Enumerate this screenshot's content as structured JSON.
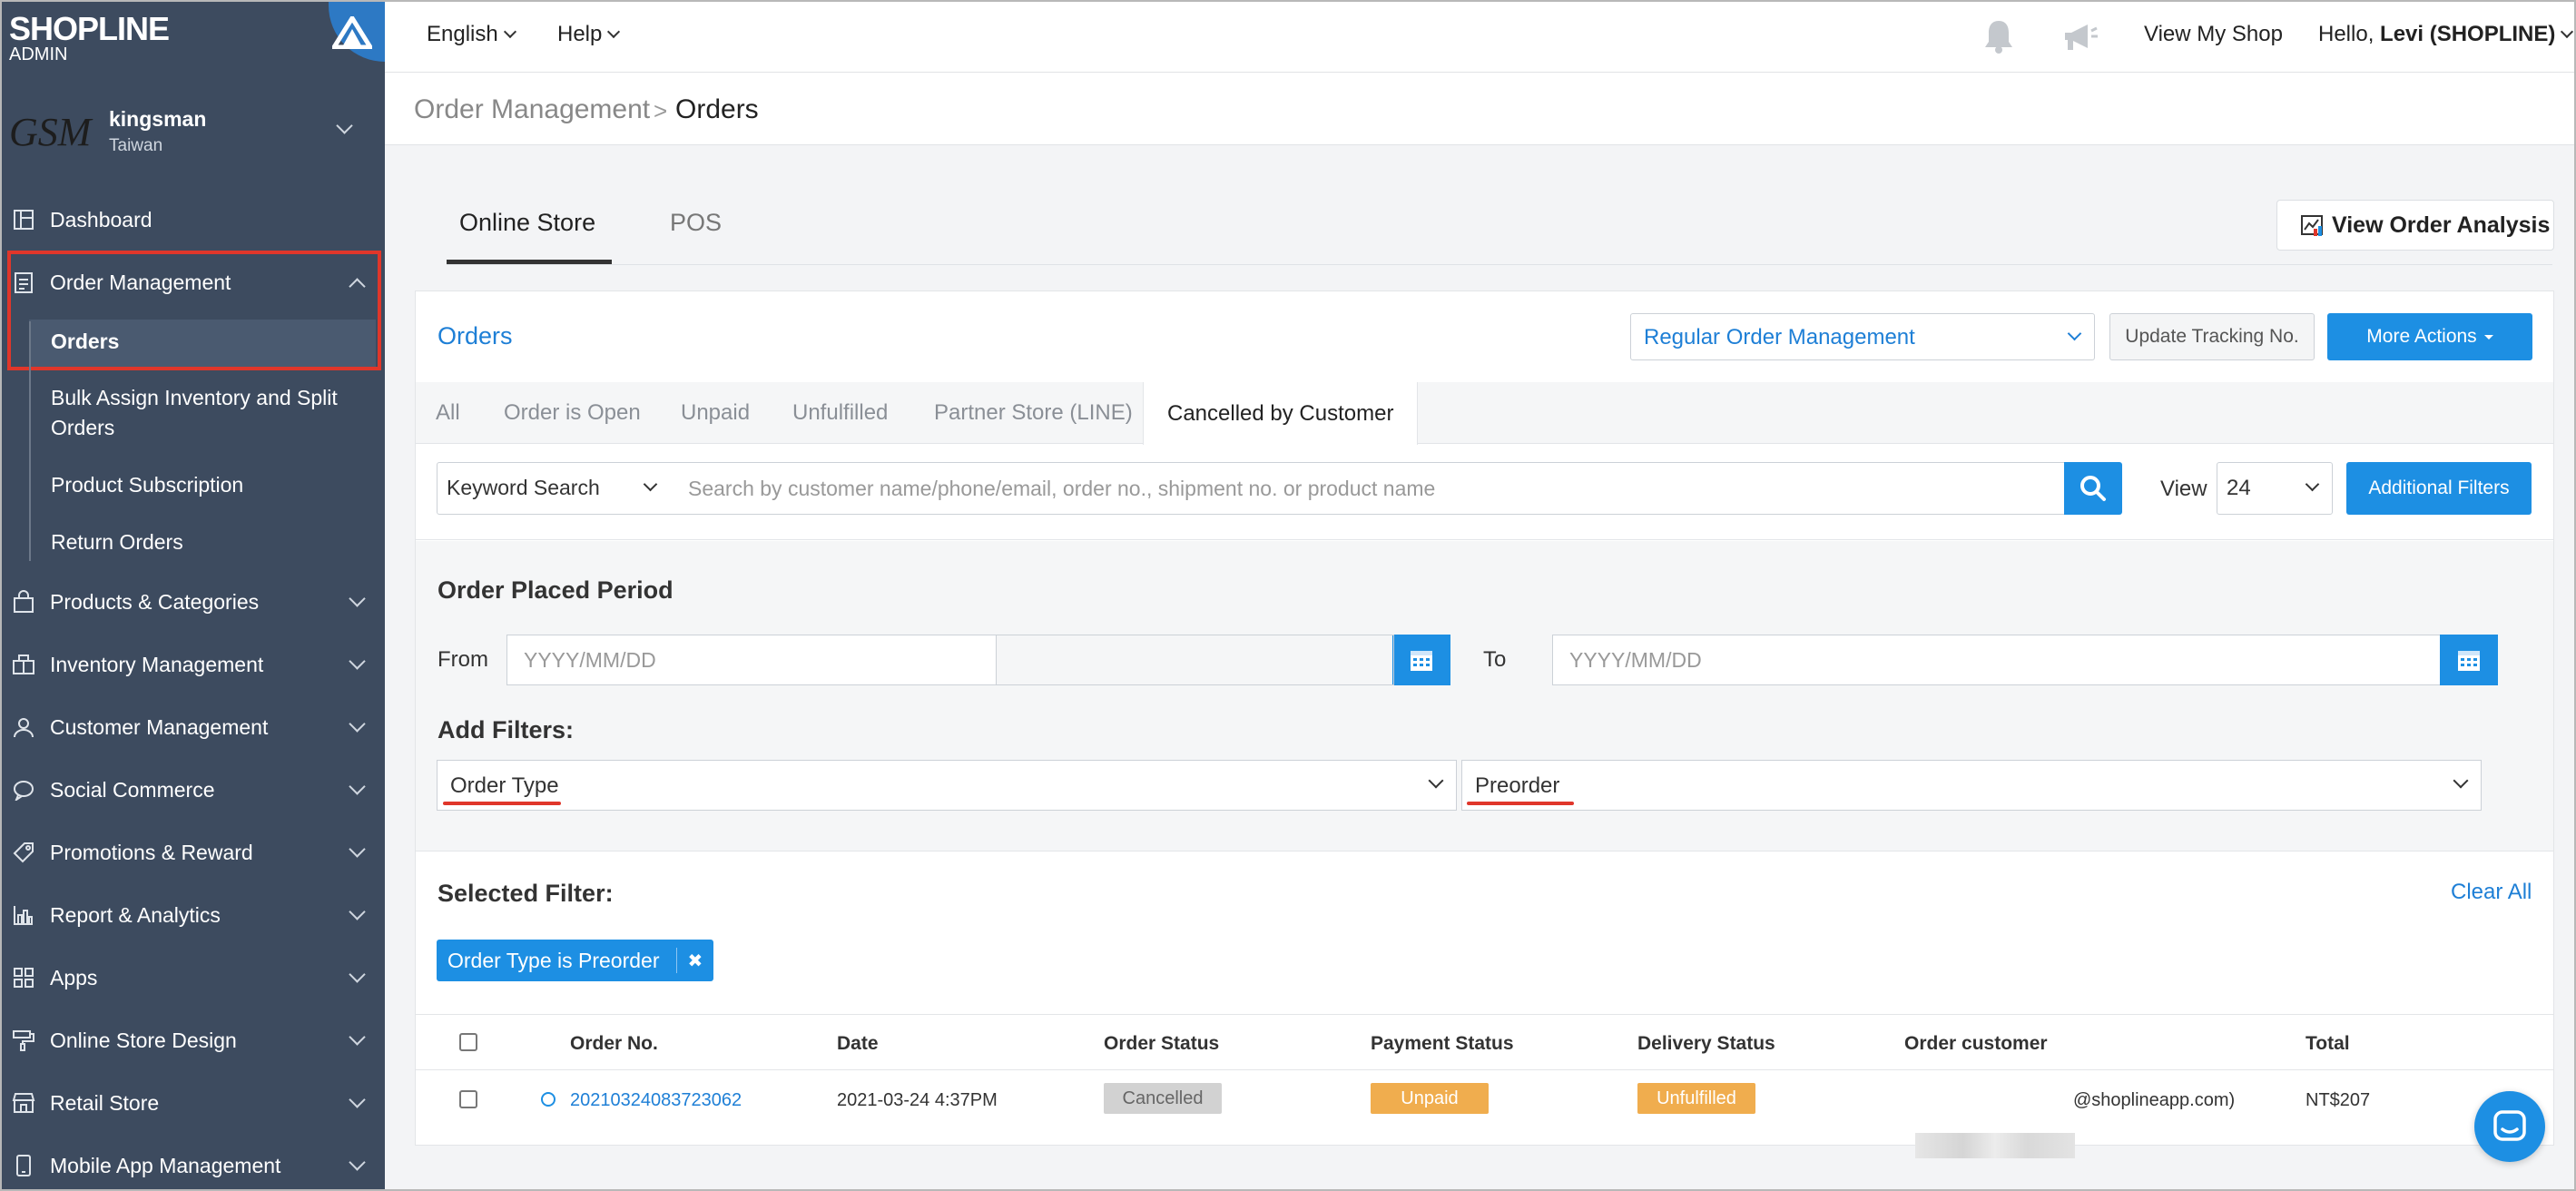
{
  "app": {
    "brand": "SHOPLINE",
    "brand_sub": "ADMIN"
  },
  "store": {
    "logo_text": "GSM",
    "name": "kingsman",
    "region": "Taiwan"
  },
  "sidebar": {
    "items": [
      {
        "label": "Dashboard",
        "icon": "dashboard-icon"
      },
      {
        "label": "Order Management",
        "icon": "clipboard-icon",
        "expanded": true
      },
      {
        "label": "Products & Categories",
        "icon": "bag-icon"
      },
      {
        "label": "Inventory Management",
        "icon": "warehouse-icon"
      },
      {
        "label": "Customer Management",
        "icon": "person-icon"
      },
      {
        "label": "Social Commerce",
        "icon": "chat-bubble-icon"
      },
      {
        "label": "Promotions & Reward",
        "icon": "tag-icon"
      },
      {
        "label": "Report & Analytics",
        "icon": "bar-chart-icon"
      },
      {
        "label": "Apps",
        "icon": "grid-icon"
      },
      {
        "label": "Online Store Design",
        "icon": "paint-roller-icon"
      },
      {
        "label": "Retail Store",
        "icon": "store-icon"
      },
      {
        "label": "Mobile App Management",
        "icon": "mobile-icon"
      }
    ],
    "sub_items": [
      "Orders",
      "Bulk Assign Inventory and Split Orders",
      "Product Subscription",
      "Return Orders"
    ],
    "bulk_line1": "Bulk Assign Inventory and Split",
    "bulk_line2": "Orders"
  },
  "topbar": {
    "language": "English",
    "help": "Help",
    "view_shop": "View My Shop",
    "greeting": "Hello,",
    "user": "Levi (SHOPLINE)"
  },
  "breadcrumb": {
    "parent": "Order Management",
    "current": "Orders",
    "separator": ">"
  },
  "channel_tabs": [
    "Online Store",
    "POS"
  ],
  "view_analysis": "View Order Analysis",
  "orders": {
    "title": "Orders",
    "management_select": "Regular Order Management",
    "update_tracking": "Update Tracking No.",
    "more_actions": "More Actions",
    "status_tabs": [
      "All",
      "Order is Open",
      "Unpaid",
      "Unfulfilled",
      "Partner Store (LINE)",
      "Cancelled by Customer"
    ],
    "active_status_tab": "Cancelled by Customer",
    "keyword_select": "Keyword Search",
    "search_placeholder": "Search by customer name/phone/email, order no., shipment no. or product name",
    "view_label": "View",
    "view_value": "24",
    "additional_filters": "Additional Filters"
  },
  "filters": {
    "period_title": "Order Placed Period",
    "from_label": "From",
    "to_label": "To",
    "date_placeholder": "YYYY/MM/DD",
    "add_filters_title": "Add Filters:",
    "filter_field": "Order Type",
    "filter_value": "Preorder",
    "selected_title": "Selected Filter:",
    "clear_all": "Clear All",
    "chip_label": "Order Type is Preorder",
    "chip_remove": "✖"
  },
  "table": {
    "headers": [
      "Order No.",
      "Date",
      "Order Status",
      "Payment Status",
      "Delivery Status",
      "Order customer",
      "Total"
    ],
    "rows": [
      {
        "order_no": "20210324083723062",
        "date": "2021-03-24 4:37PM",
        "order_status": "Cancelled",
        "payment_status": "Unpaid",
        "delivery_status": "Unfulfilled",
        "customer": "@shoplineapp.com)",
        "total": "NT$207"
      }
    ]
  },
  "colors": {
    "sidebar": "#3d4b5f",
    "accent": "#1d8fe3",
    "link": "#1e7fd6",
    "highlight": "#e0362a",
    "warning": "#f0ad4e",
    "muted_badge": "#d2d2d2"
  }
}
